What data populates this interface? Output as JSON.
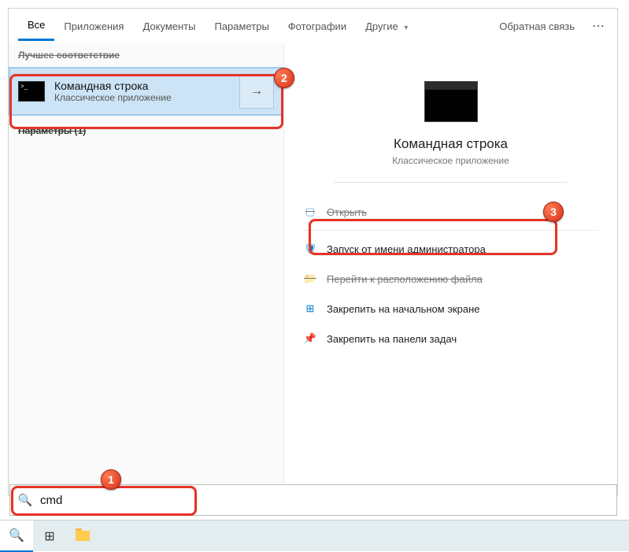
{
  "tabs": {
    "all": "Все",
    "apps": "Приложения",
    "docs": "Документы",
    "settings": "Параметры",
    "photos": "Фотографии",
    "more": "Другие"
  },
  "header": {
    "feedback": "Обратная связь",
    "more": "⋯"
  },
  "left": {
    "section": "Лучшее соответствие",
    "title": "Командная строка",
    "subtitle": "Классическое приложение",
    "params_section": "Параметры (1)"
  },
  "preview": {
    "title": "Командная строка",
    "subtitle": "Классическое приложение"
  },
  "actions": {
    "open": "Открыть",
    "run_admin": "Запуск от имени администратора",
    "open_location": "Перейти к расположению файла",
    "pin_start": "Закрепить на начальном экране",
    "pin_taskbar": "Закрепить на панели задач"
  },
  "search": {
    "value": "cmd"
  },
  "badges": {
    "b1": "1",
    "b2": "2",
    "b3": "3"
  }
}
